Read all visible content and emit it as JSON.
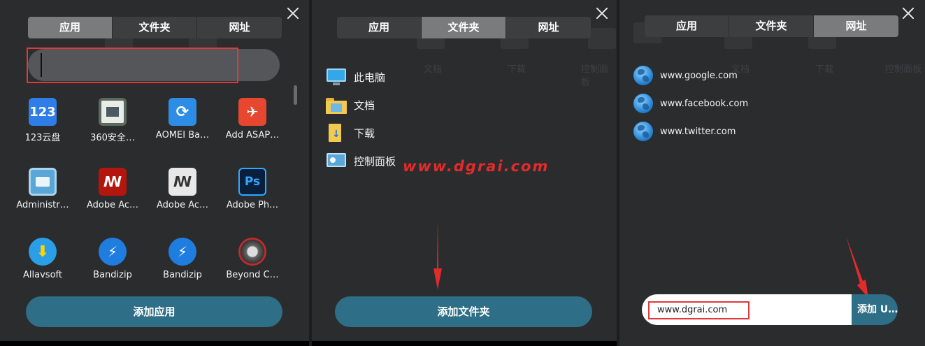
{
  "tabs": [
    "应用",
    "文件夹",
    "网址"
  ],
  "ghost_labels": [
    "文档",
    "下载",
    "控制面板"
  ],
  "panel_apps": {
    "search": {
      "value": "",
      "placeholder": ""
    },
    "apps": [
      {
        "label": "123云盘",
        "icon": "123-cloud-icon",
        "color": "#2f7ee8"
      },
      {
        "label": "360安全…",
        "icon": "360-security-icon",
        "color": "#e8ebe6"
      },
      {
        "label": "AOMEI Ba…",
        "icon": "aomei-backupper-icon",
        "color": "#2d8de6"
      },
      {
        "label": "Add ASAP…",
        "icon": "asap-utilities-icon",
        "color": "#e6472e"
      },
      {
        "label": "Administr…",
        "icon": "administrator-icon",
        "color": "#5aa6d6"
      },
      {
        "label": "Adobe Ac…",
        "icon": "adobe-acrobat-icon",
        "color": "#b3160c"
      },
      {
        "label": "Adobe Ac…",
        "icon": "adobe-acrobat-reader-icon",
        "color": "#e8e8e8"
      },
      {
        "label": "Adobe Ph…",
        "icon": "adobe-photoshop-icon",
        "color": "#0a1f3b"
      },
      {
        "label": "Allavsoft",
        "icon": "allavsoft-icon",
        "color": "#2a9ee6"
      },
      {
        "label": "Bandizip",
        "icon": "bandizip-icon",
        "color": "#1f7de0"
      },
      {
        "label": "Bandizip",
        "icon": "bandizip-icon",
        "color": "#1f7de0"
      },
      {
        "label": "Beyond C…",
        "icon": "beyond-compare-icon",
        "color": "#c72a2a"
      }
    ],
    "add_button": "添加应用"
  },
  "panel_folders": {
    "folders": [
      {
        "label": "此电脑",
        "icon": "this-pc-icon"
      },
      {
        "label": "文档",
        "icon": "documents-folder-icon"
      },
      {
        "label": "下载",
        "icon": "downloads-folder-icon"
      },
      {
        "label": "控制面板",
        "icon": "control-panel-icon"
      }
    ],
    "watermark": "www.dgrai.com",
    "add_button": "添加文件夹"
  },
  "panel_urls": {
    "urls": [
      "www.google.com",
      "www.facebook.com",
      "www.twitter.com"
    ],
    "input_value": "www.dgrai.com",
    "add_button": "添加 U…"
  },
  "colors": {
    "panel_bg": "#2b2c2e",
    "tab_active": "#7a7b7d",
    "button": "#2e6e86",
    "highlight": "#e0393b"
  }
}
